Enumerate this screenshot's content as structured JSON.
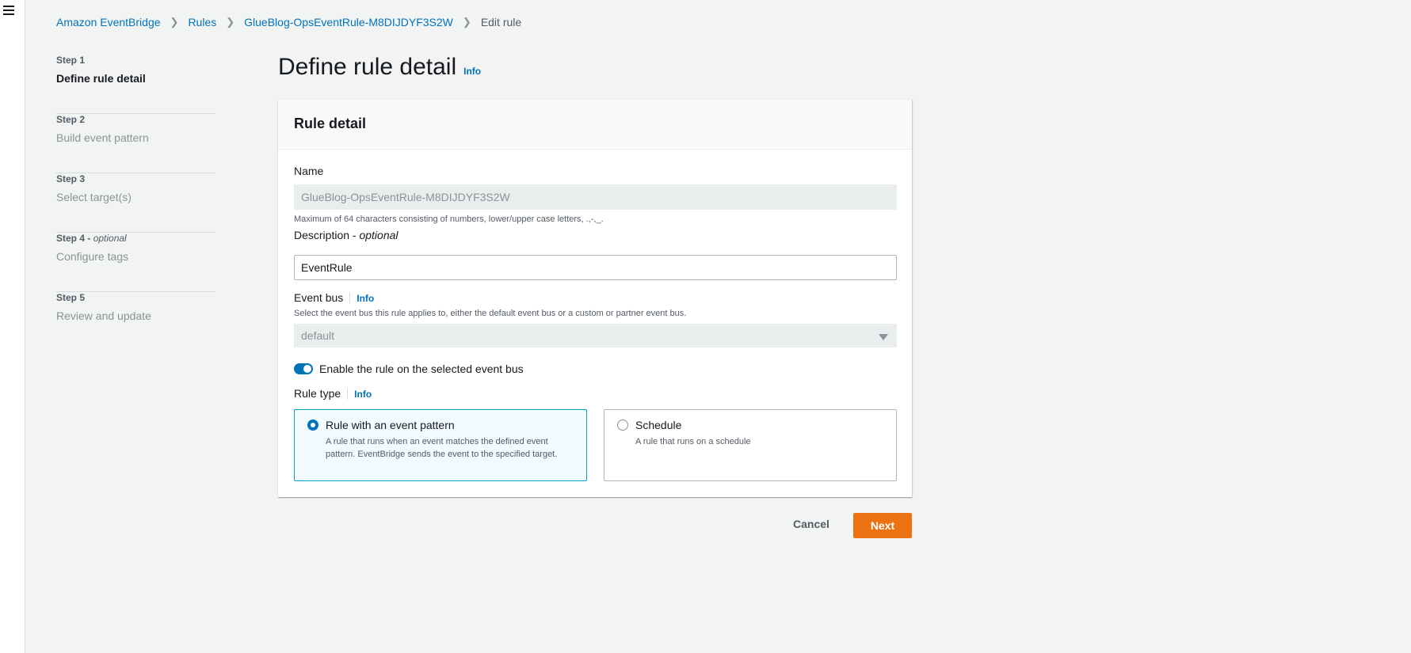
{
  "breadcrumb": {
    "items": [
      "Amazon EventBridge",
      "Rules",
      "GlueBlog-OpsEventRule-M8DIJDYF3S2W"
    ],
    "current": "Edit rule"
  },
  "steps": [
    {
      "num": "Step 1",
      "optional": "",
      "title": "Define rule detail",
      "active": true
    },
    {
      "num": "Step 2",
      "optional": "",
      "title": "Build event pattern",
      "active": false
    },
    {
      "num": "Step 3",
      "optional": "",
      "title": "Select target(s)",
      "active": false
    },
    {
      "num": "Step 4",
      "optional": "optional",
      "title": "Configure tags",
      "active": false
    },
    {
      "num": "Step 5",
      "optional": "",
      "title": "Review and update",
      "active": false
    }
  ],
  "page": {
    "title": "Define rule detail",
    "info": "Info"
  },
  "panel": {
    "header": "Rule detail",
    "name": {
      "label": "Name",
      "value": "GlueBlog-OpsEventRule-M8DIJDYF3S2W",
      "hint": "Maximum of 64 characters consisting of numbers, lower/upper case letters, .,-,_."
    },
    "description": {
      "label": "Description - ",
      "label_optional": "optional",
      "value": "EventRule"
    },
    "event_bus": {
      "label": "Event bus",
      "info": "Info",
      "hint": "Select the event bus this rule applies to, either the default event bus or a custom or partner event bus.",
      "value": "default"
    },
    "enable_toggle": {
      "label": "Enable the rule on the selected event bus",
      "checked": true
    },
    "rule_type": {
      "label": "Rule type",
      "info": "Info",
      "options": [
        {
          "title": "Rule with an event pattern",
          "desc": "A rule that runs when an event matches the defined event pattern. EventBridge sends the event to the specified target.",
          "selected": true
        },
        {
          "title": "Schedule",
          "desc": "A rule that runs on a schedule",
          "selected": false
        }
      ]
    }
  },
  "actions": {
    "cancel": "Cancel",
    "next": "Next"
  },
  "colors": {
    "link": "#0073bb",
    "primary_button": "#ec7211",
    "background": "#f2f3f3"
  }
}
